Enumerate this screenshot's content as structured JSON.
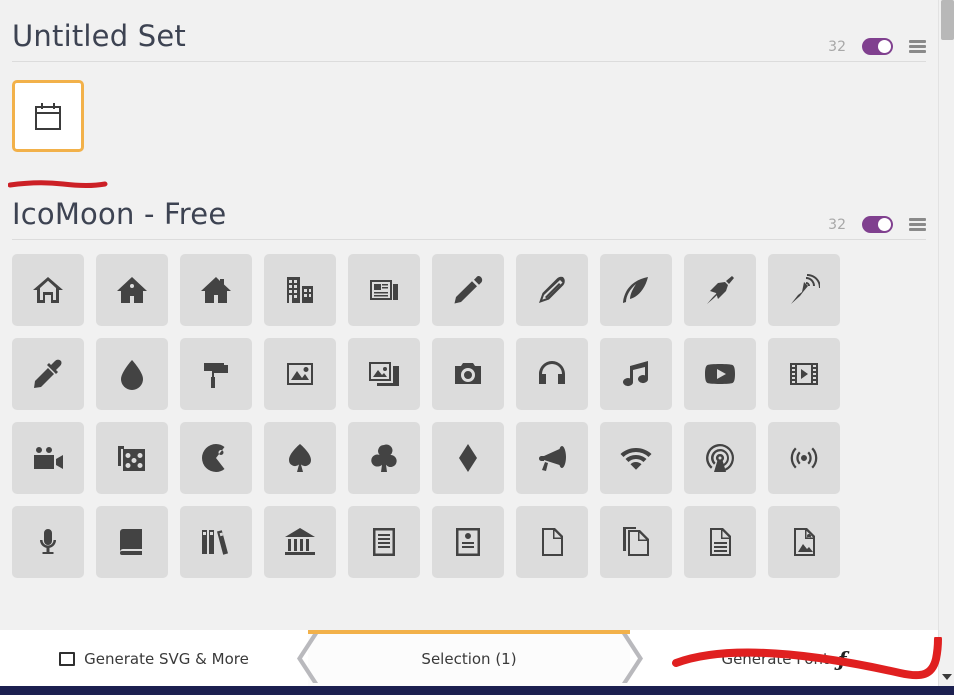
{
  "app": {
    "name": "IcoMoon"
  },
  "sets": [
    {
      "title": "Untitled Set",
      "count": "32",
      "toggle_state": "on",
      "icons": [
        {
          "name": "calendar",
          "glyph": "calendar"
        }
      ]
    },
    {
      "title": "IcoMoon - Free",
      "count": "32",
      "toggle_state": "on",
      "icons": [
        {
          "name": "home"
        },
        {
          "name": "home2"
        },
        {
          "name": "home3"
        },
        {
          "name": "office"
        },
        {
          "name": "newspaper"
        },
        {
          "name": "pencil"
        },
        {
          "name": "pencil2"
        },
        {
          "name": "quill"
        },
        {
          "name": "pen"
        },
        {
          "name": "blog"
        },
        {
          "name": "eyedropper"
        },
        {
          "name": "droplet"
        },
        {
          "name": "paint-format"
        },
        {
          "name": "image"
        },
        {
          "name": "images"
        },
        {
          "name": "camera"
        },
        {
          "name": "headphones"
        },
        {
          "name": "music"
        },
        {
          "name": "play"
        },
        {
          "name": "film"
        },
        {
          "name": "video-camera"
        },
        {
          "name": "dice"
        },
        {
          "name": "pacman"
        },
        {
          "name": "spades"
        },
        {
          "name": "clubs"
        },
        {
          "name": "diamonds"
        },
        {
          "name": "bullhorn"
        },
        {
          "name": "connection"
        },
        {
          "name": "podcast"
        },
        {
          "name": "feed"
        },
        {
          "name": "mic"
        },
        {
          "name": "book"
        },
        {
          "name": "books"
        },
        {
          "name": "library"
        },
        {
          "name": "file-text"
        },
        {
          "name": "profile"
        },
        {
          "name": "file-empty"
        },
        {
          "name": "files-empty"
        },
        {
          "name": "file-text2"
        },
        {
          "name": "file-picture"
        }
      ]
    }
  ],
  "tabbar": {
    "generate_svg_label": "Generate SVG & More",
    "generate_svg_icon": "image-icon",
    "selection_label": "Selection (1)",
    "selection_active": true,
    "generate_font_label": "Generate Font",
    "generate_font_icon": "f-glyph-icon"
  },
  "annotations": [
    {
      "name": "red-underline",
      "color": "#cc2026"
    },
    {
      "name": "red-swoosh",
      "color": "#e02020"
    }
  ],
  "colors": {
    "accent_orange": "#f2b14a",
    "toggle_purple": "#80408f",
    "cell_gray": "#dcdcdc",
    "page_bg": "#f1f1f1",
    "bottom_strip": "#1c2050"
  },
  "scrollbar": {
    "position": "top"
  }
}
